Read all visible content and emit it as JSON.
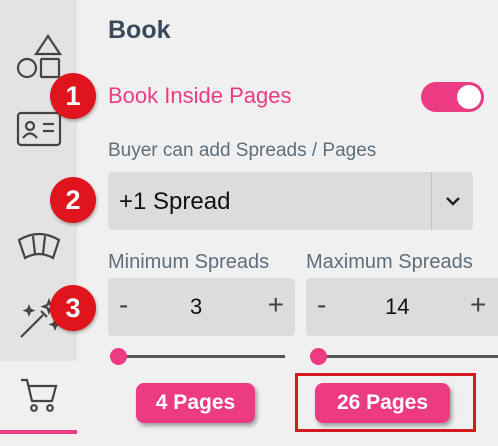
{
  "sidebar": {
    "items": [
      {
        "icon": "shapes-icon"
      },
      {
        "icon": "id-card-icon"
      },
      {
        "icon": "curved-text-icon"
      },
      {
        "icon": "magic-wand-icon"
      },
      {
        "icon": "cart-icon",
        "active": true
      }
    ]
  },
  "panel": {
    "title": "Book",
    "toggle": {
      "label": "Book Inside Pages",
      "on": true
    },
    "spreads_label": "Buyer can add Spreads / Pages",
    "spreads_select": {
      "value": "+1 Spread"
    },
    "min": {
      "label": "Minimum Spreads",
      "value": "3",
      "minus": "-",
      "plus": "+",
      "slider_fraction": 0
    },
    "max": {
      "label": "Maximum Spreads",
      "value": "14",
      "minus": "-",
      "plus": "+",
      "slider_fraction": 0
    },
    "min_pages": "4 Pages",
    "max_pages": "26 Pages"
  },
  "annotations": {
    "one": "1",
    "two": "2",
    "three": "3"
  },
  "colors": {
    "accent": "#ec3b83",
    "annotation": "#e0141c",
    "title": "#3a4a5c",
    "label": "#5f6e7c"
  }
}
